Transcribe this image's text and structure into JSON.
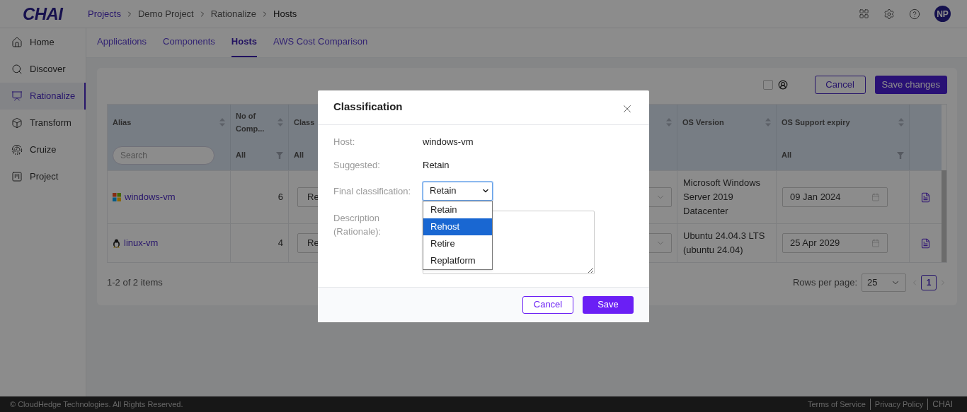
{
  "header": {
    "logo": "CHAI",
    "breadcrumb": [
      {
        "label": "Projects",
        "link": true
      },
      {
        "label": "Demo Project",
        "link": false
      },
      {
        "label": "Rationalize",
        "link": false
      },
      {
        "label": "Hosts",
        "link": false
      }
    ],
    "avatar": "NP"
  },
  "sidebar": {
    "items": [
      {
        "label": "Home",
        "selected": false
      },
      {
        "label": "Discover",
        "selected": false
      },
      {
        "label": "Rationalize",
        "selected": true
      },
      {
        "label": "Transform",
        "selected": false
      },
      {
        "label": "Cruize",
        "selected": false
      },
      {
        "label": "Project",
        "selected": false
      }
    ]
  },
  "tabs": [
    {
      "label": "Applications",
      "selected": false
    },
    {
      "label": "Components",
      "selected": false
    },
    {
      "label": "Hosts",
      "selected": true
    },
    {
      "label": "AWS Cost Comparison",
      "selected": false
    }
  ],
  "toolbar": {
    "checked": false,
    "buttons": [
      "Cancel",
      "Save changes"
    ]
  },
  "table": {
    "columns": [
      {
        "header": "Alias",
        "sortable": true,
        "filter": {
          "kind": "search",
          "placeholder": "Search"
        }
      },
      {
        "header": "No of Comp...",
        "sortable": true,
        "filter": {
          "kind": "select",
          "value": "All",
          "funnel": true
        }
      },
      {
        "header": "Class",
        "filter": {
          "kind": "select",
          "value": "All",
          "funnel": false
        }
      },
      {
        "sortable": true
      },
      {
        "header": "OS Version",
        "sortable": true
      },
      {
        "header": "OS Support expiry",
        "sortable": true,
        "filter": {
          "kind": "select",
          "value": "All",
          "funnel": true
        }
      },
      {}
    ],
    "rows": [
      {
        "kind": "windows",
        "alias": "windows-vm",
        "components": "6",
        "classification": "Re",
        "os_version": "Microsoft Windows Server 2019 Datacenter",
        "support_expiry": "09 Jan 2024"
      },
      {
        "kind": "linux",
        "alias": "linux-vm",
        "components": "4",
        "classification": "Re",
        "os_version": "Ubuntu 24.04.3 LTS (ubuntu 24.04)",
        "support_expiry": "25 Apr 2029"
      }
    ]
  },
  "pagination": {
    "summary": "1-2 of 2 items",
    "rows_per_page_label": "Rows per page:",
    "rows_per_page": "25",
    "pages": [
      {
        "label": "1",
        "selected": true
      }
    ]
  },
  "dialog": {
    "title": "Classification",
    "fields": [
      {
        "kind": "text",
        "label": "Host:",
        "value": "windows-vm"
      },
      {
        "kind": "text",
        "label": "Suggested:",
        "value": "Retain"
      },
      {
        "kind": "select",
        "label": "Final classification:",
        "value": "Retain",
        "expanded": true,
        "options": [
          {
            "label": "Retain",
            "highlighted": false
          },
          {
            "label": "Rehost",
            "highlighted": true
          },
          {
            "label": "Retire",
            "highlighted": false
          },
          {
            "label": "Replatform",
            "highlighted": false
          }
        ]
      },
      {
        "kind": "textarea",
        "label": "Description (Rationale):"
      }
    ],
    "buttons": [
      {
        "kind": "secondary",
        "label": "Cancel"
      },
      {
        "kind": "primary",
        "label": "Save"
      }
    ]
  },
  "footer": {
    "copyright": "© CloudHedge Technologies. All Rights Reserved.",
    "links": [
      "Terms of Service",
      "Privacy Policy",
      "CHAI"
    ]
  }
}
